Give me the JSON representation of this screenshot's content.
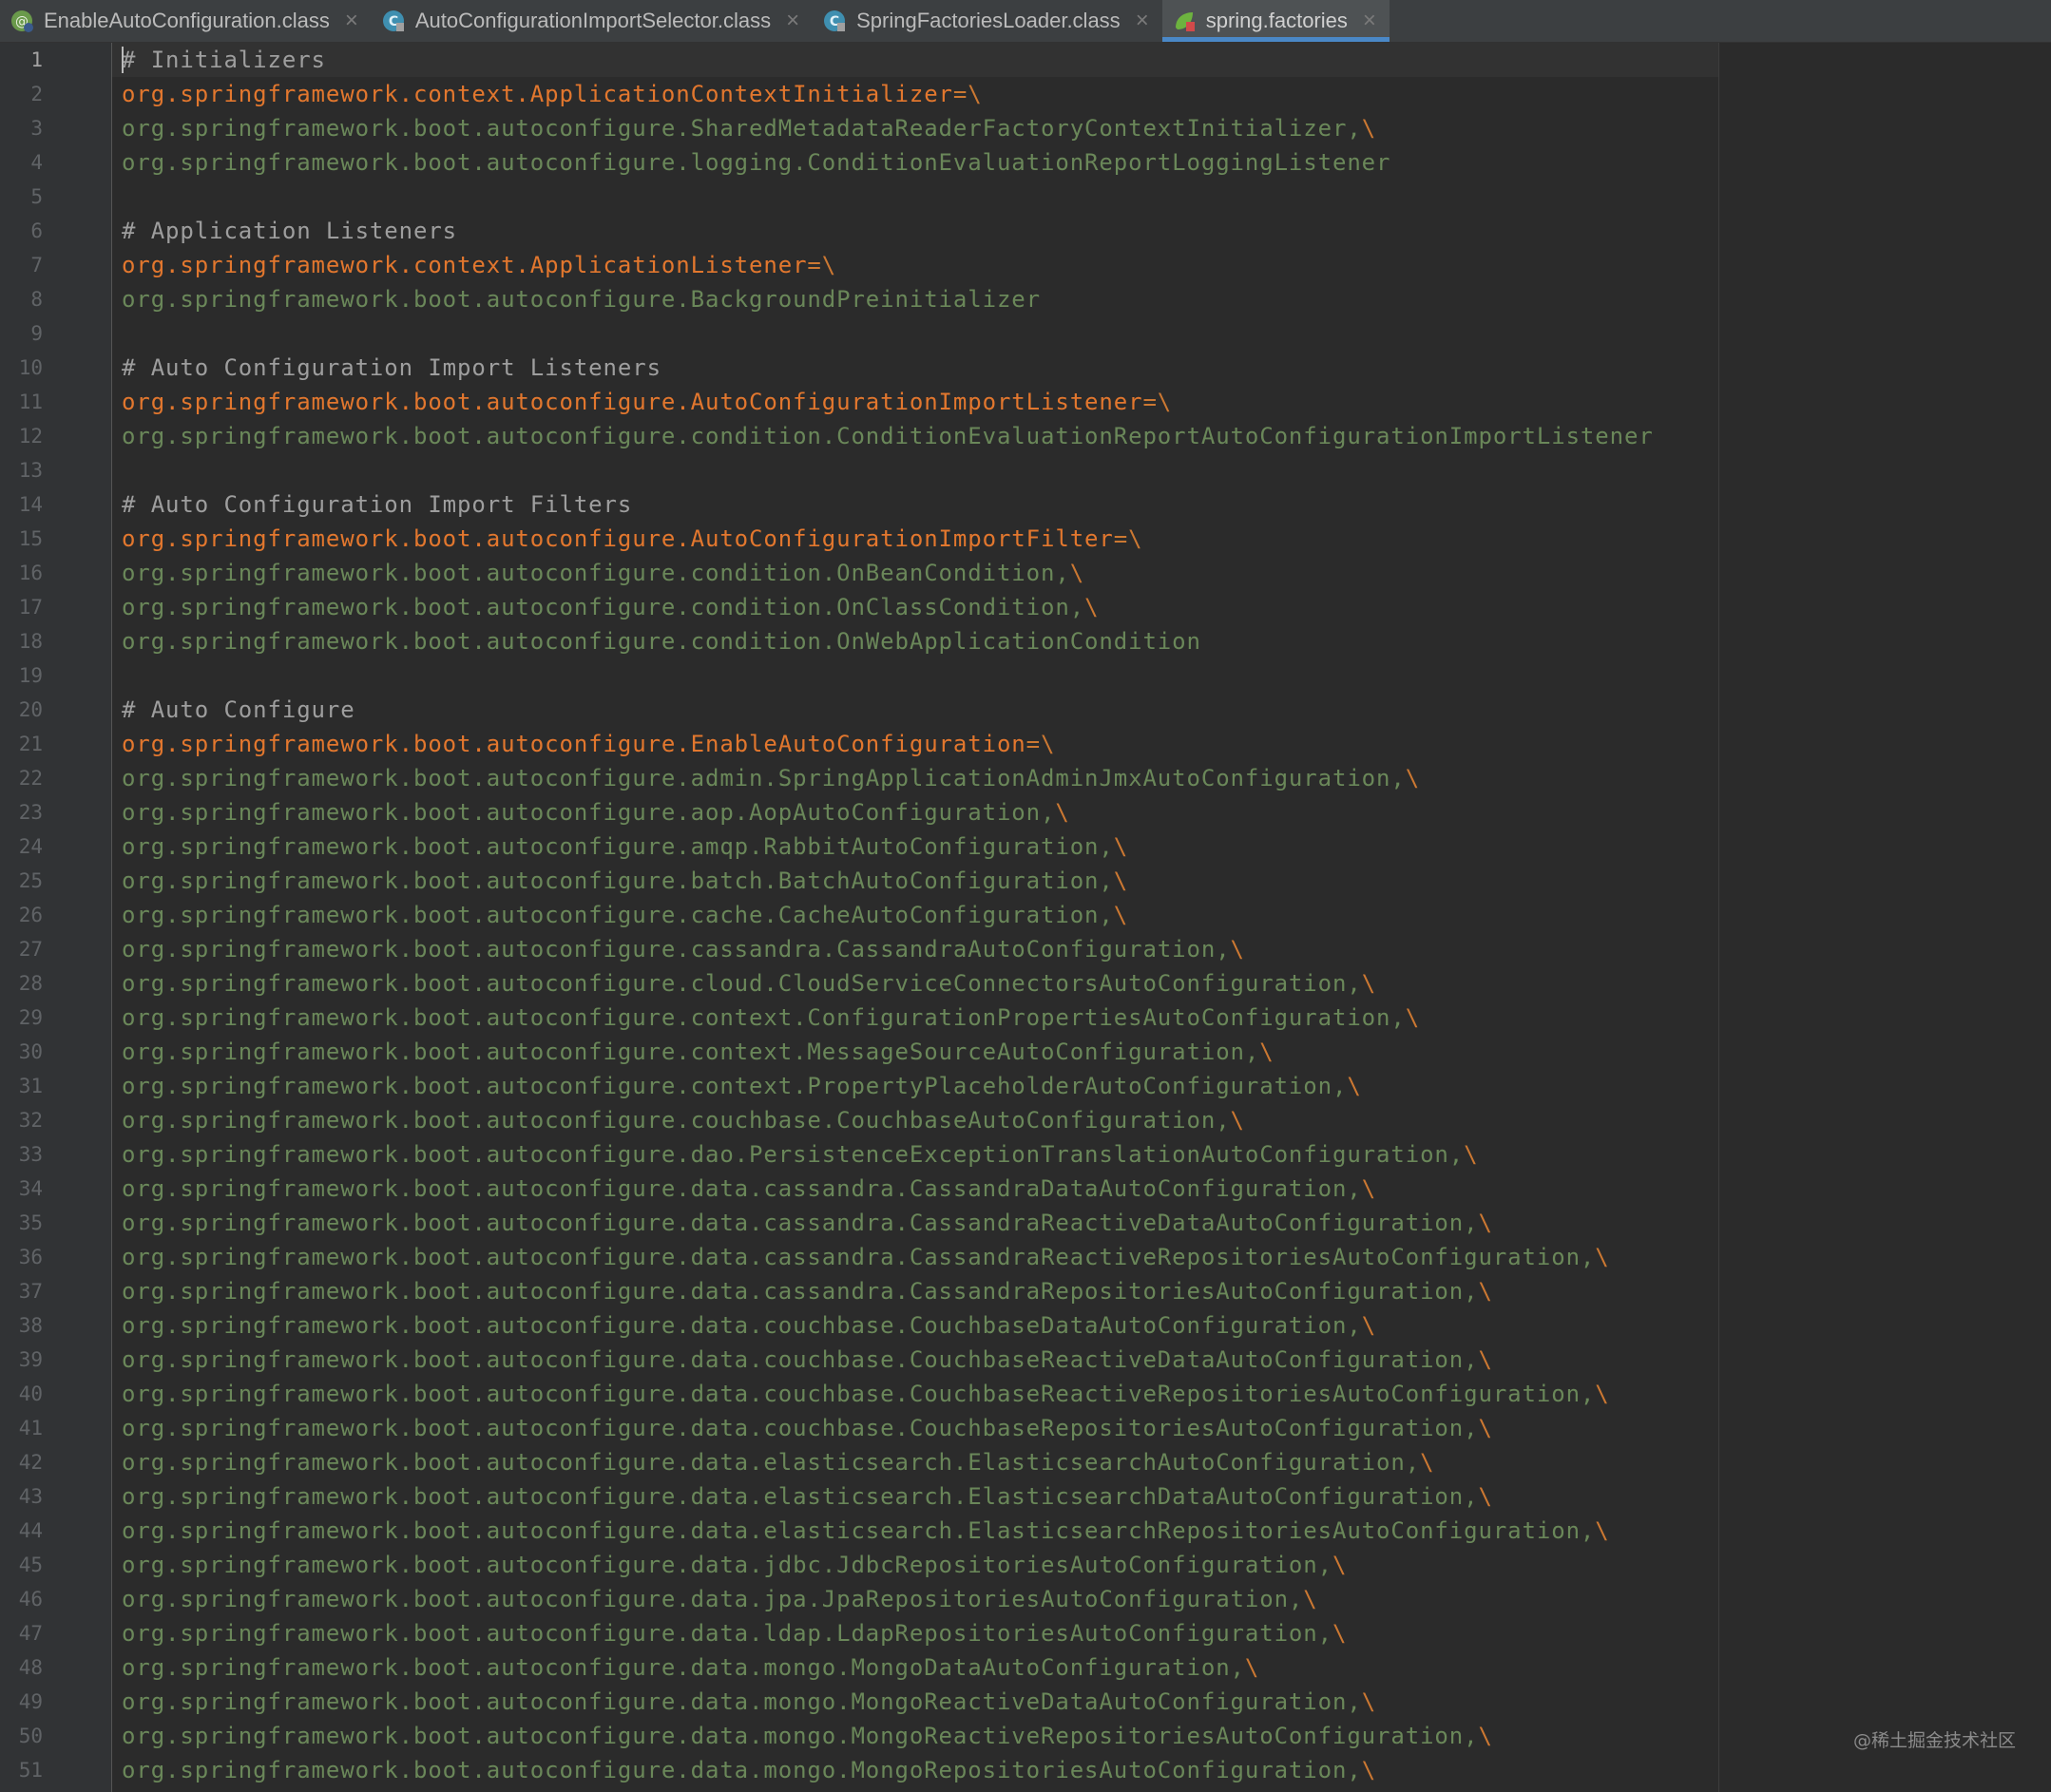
{
  "tabs": [
    {
      "label": "EnableAutoConfiguration.class",
      "icon": "annotation-class-icon",
      "active": false
    },
    {
      "label": "AutoConfigurationImportSelector.class",
      "icon": "class-file-icon",
      "active": false
    },
    {
      "label": "SpringFactoriesLoader.class",
      "icon": "class-file-icon",
      "active": false
    },
    {
      "label": "spring.factories",
      "icon": "spring-properties-icon",
      "active": true
    }
  ],
  "close_glyph": "×",
  "current_line": 1,
  "lines": [
    {
      "t": "comment",
      "text": "# Initializers"
    },
    {
      "t": "key",
      "text": "org.springframework.context.ApplicationContextInitializer",
      "sep": "=\\"
    },
    {
      "t": "value",
      "text": "org.springframework.boot.autoconfigure.SharedMetadataReaderFactoryContextInitializer,",
      "sep": "\\"
    },
    {
      "t": "value",
      "text": "org.springframework.boot.autoconfigure.logging.ConditionEvaluationReportLoggingListener",
      "sep": ""
    },
    {
      "t": "blank",
      "text": ""
    },
    {
      "t": "comment",
      "text": "# Application Listeners"
    },
    {
      "t": "key",
      "text": "org.springframework.context.ApplicationListener",
      "sep": "=\\"
    },
    {
      "t": "value",
      "text": "org.springframework.boot.autoconfigure.BackgroundPreinitializer",
      "sep": ""
    },
    {
      "t": "blank",
      "text": ""
    },
    {
      "t": "comment",
      "text": "# Auto Configuration Import Listeners"
    },
    {
      "t": "key",
      "text": "org.springframework.boot.autoconfigure.AutoConfigurationImportListener",
      "sep": "=\\"
    },
    {
      "t": "value",
      "text": "org.springframework.boot.autoconfigure.condition.ConditionEvaluationReportAutoConfigurationImportListener",
      "sep": ""
    },
    {
      "t": "blank",
      "text": ""
    },
    {
      "t": "comment",
      "text": "# Auto Configuration Import Filters"
    },
    {
      "t": "key",
      "text": "org.springframework.boot.autoconfigure.AutoConfigurationImportFilter",
      "sep": "=\\"
    },
    {
      "t": "value",
      "text": "org.springframework.boot.autoconfigure.condition.OnBeanCondition,",
      "sep": "\\"
    },
    {
      "t": "value",
      "text": "org.springframework.boot.autoconfigure.condition.OnClassCondition,",
      "sep": "\\"
    },
    {
      "t": "value",
      "text": "org.springframework.boot.autoconfigure.condition.OnWebApplicationCondition",
      "sep": ""
    },
    {
      "t": "blank",
      "text": ""
    },
    {
      "t": "comment",
      "text": "# Auto Configure"
    },
    {
      "t": "key",
      "text": "org.springframework.boot.autoconfigure.EnableAutoConfiguration",
      "sep": "=\\"
    },
    {
      "t": "value",
      "text": "org.springframework.boot.autoconfigure.admin.SpringApplicationAdminJmxAutoConfiguration,",
      "sep": "\\"
    },
    {
      "t": "value",
      "text": "org.springframework.boot.autoconfigure.aop.AopAutoConfiguration,",
      "sep": "\\"
    },
    {
      "t": "value",
      "text": "org.springframework.boot.autoconfigure.amqp.RabbitAutoConfiguration,",
      "sep": "\\"
    },
    {
      "t": "value",
      "text": "org.springframework.boot.autoconfigure.batch.BatchAutoConfiguration,",
      "sep": "\\"
    },
    {
      "t": "value",
      "text": "org.springframework.boot.autoconfigure.cache.CacheAutoConfiguration,",
      "sep": "\\"
    },
    {
      "t": "value",
      "text": "org.springframework.boot.autoconfigure.cassandra.CassandraAutoConfiguration,",
      "sep": "\\"
    },
    {
      "t": "value",
      "text": "org.springframework.boot.autoconfigure.cloud.CloudServiceConnectorsAutoConfiguration,",
      "sep": "\\"
    },
    {
      "t": "value",
      "text": "org.springframework.boot.autoconfigure.context.ConfigurationPropertiesAutoConfiguration,",
      "sep": "\\"
    },
    {
      "t": "value",
      "text": "org.springframework.boot.autoconfigure.context.MessageSourceAutoConfiguration,",
      "sep": "\\"
    },
    {
      "t": "value",
      "text": "org.springframework.boot.autoconfigure.context.PropertyPlaceholderAutoConfiguration,",
      "sep": "\\"
    },
    {
      "t": "value",
      "text": "org.springframework.boot.autoconfigure.couchbase.CouchbaseAutoConfiguration,",
      "sep": "\\"
    },
    {
      "t": "value",
      "text": "org.springframework.boot.autoconfigure.dao.PersistenceExceptionTranslationAutoConfiguration,",
      "sep": "\\"
    },
    {
      "t": "value",
      "text": "org.springframework.boot.autoconfigure.data.cassandra.CassandraDataAutoConfiguration,",
      "sep": "\\"
    },
    {
      "t": "value",
      "text": "org.springframework.boot.autoconfigure.data.cassandra.CassandraReactiveDataAutoConfiguration,",
      "sep": "\\"
    },
    {
      "t": "value",
      "text": "org.springframework.boot.autoconfigure.data.cassandra.CassandraReactiveRepositoriesAutoConfiguration,",
      "sep": "\\"
    },
    {
      "t": "value",
      "text": "org.springframework.boot.autoconfigure.data.cassandra.CassandraRepositoriesAutoConfiguration,",
      "sep": "\\"
    },
    {
      "t": "value",
      "text": "org.springframework.boot.autoconfigure.data.couchbase.CouchbaseDataAutoConfiguration,",
      "sep": "\\"
    },
    {
      "t": "value",
      "text": "org.springframework.boot.autoconfigure.data.couchbase.CouchbaseReactiveDataAutoConfiguration,",
      "sep": "\\"
    },
    {
      "t": "value",
      "text": "org.springframework.boot.autoconfigure.data.couchbase.CouchbaseReactiveRepositoriesAutoConfiguration,",
      "sep": "\\"
    },
    {
      "t": "value",
      "text": "org.springframework.boot.autoconfigure.data.couchbase.CouchbaseRepositoriesAutoConfiguration,",
      "sep": "\\"
    },
    {
      "t": "value",
      "text": "org.springframework.boot.autoconfigure.data.elasticsearch.ElasticsearchAutoConfiguration,",
      "sep": "\\"
    },
    {
      "t": "value",
      "text": "org.springframework.boot.autoconfigure.data.elasticsearch.ElasticsearchDataAutoConfiguration,",
      "sep": "\\"
    },
    {
      "t": "value",
      "text": "org.springframework.boot.autoconfigure.data.elasticsearch.ElasticsearchRepositoriesAutoConfiguration,",
      "sep": "\\"
    },
    {
      "t": "value",
      "text": "org.springframework.boot.autoconfigure.data.jdbc.JdbcRepositoriesAutoConfiguration,",
      "sep": "\\"
    },
    {
      "t": "value",
      "text": "org.springframework.boot.autoconfigure.data.jpa.JpaRepositoriesAutoConfiguration,",
      "sep": "\\"
    },
    {
      "t": "value",
      "text": "org.springframework.boot.autoconfigure.data.ldap.LdapRepositoriesAutoConfiguration,",
      "sep": "\\"
    },
    {
      "t": "value",
      "text": "org.springframework.boot.autoconfigure.data.mongo.MongoDataAutoConfiguration,",
      "sep": "\\"
    },
    {
      "t": "value",
      "text": "org.springframework.boot.autoconfigure.data.mongo.MongoReactiveDataAutoConfiguration,",
      "sep": "\\"
    },
    {
      "t": "value",
      "text": "org.springframework.boot.autoconfigure.data.mongo.MongoReactiveRepositoriesAutoConfiguration,",
      "sep": "\\"
    },
    {
      "t": "value",
      "text": "org.springframework.boot.autoconfigure.data.mongo.MongoRepositoriesAutoConfiguration,",
      "sep": "\\"
    }
  ],
  "watermark": "@稀土掘金技术社区",
  "colors": {
    "background": "#2b2b2b",
    "gutter": "#313335",
    "key": "#e2772e",
    "value": "#6a8759",
    "comment": "#9e9e9e",
    "separator": "#cc7832",
    "active_tab_underline": "#4a88c7"
  }
}
